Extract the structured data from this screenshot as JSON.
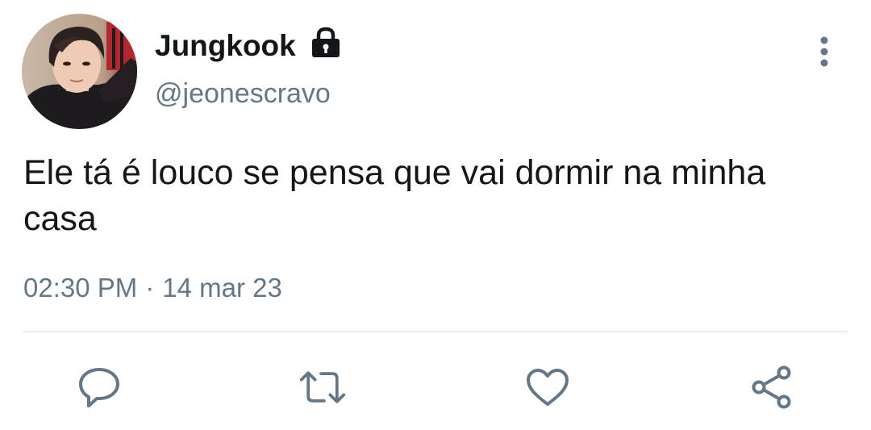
{
  "tweet": {
    "author": {
      "display_name": "Jungkook",
      "handle": "@jeonescravo",
      "protected_icon": "lock-icon"
    },
    "text": "Ele tá é louco se pensa que vai dormir na minha casa",
    "time": "02:30 PM",
    "separator": "·",
    "date": "14 mar 23"
  },
  "actions": {
    "reply_icon": "reply-icon",
    "retweet_icon": "retweet-icon",
    "like_icon": "heart-icon",
    "share_icon": "share-icon",
    "more_icon": "more-vertical-icon"
  },
  "colors": {
    "text_primary": "#14171a",
    "text_secondary": "#657786",
    "divider": "#e6ecf0",
    "icon": "#657786"
  }
}
